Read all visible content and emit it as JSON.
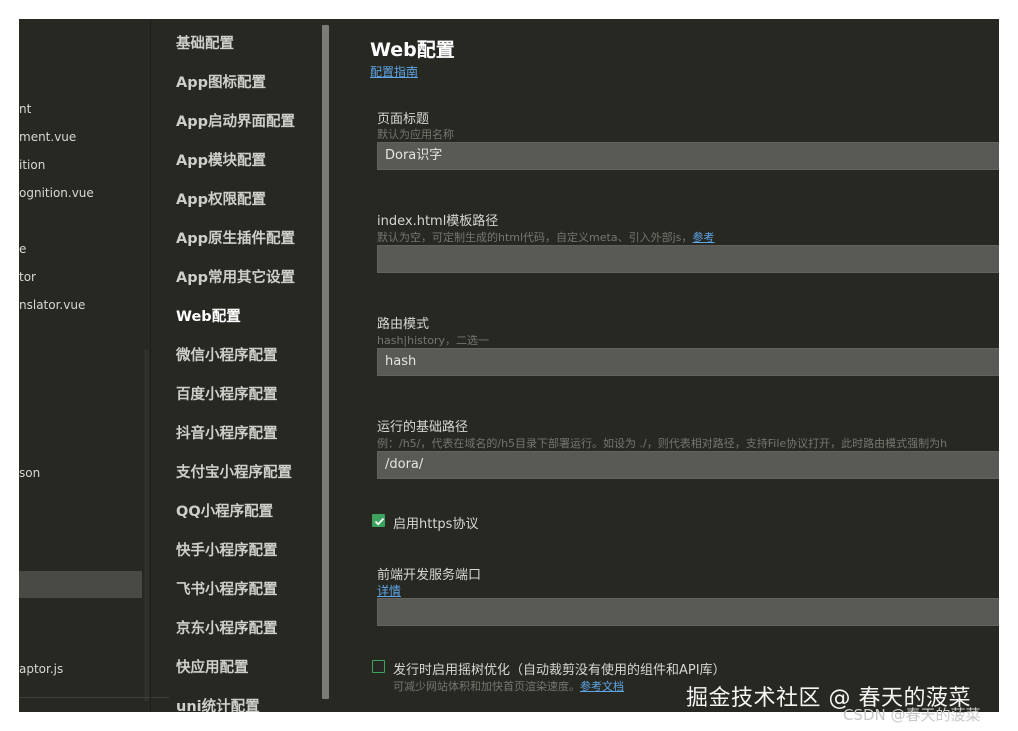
{
  "file_tree": {
    "items": [
      {
        "label": "nt"
      },
      {
        "label": "ment.vue"
      },
      {
        "label": "ition"
      },
      {
        "label": "ognition.vue"
      },
      {
        "label": "e"
      },
      {
        "label": "tor"
      },
      {
        "label": "nslator.vue"
      },
      {
        "label": "son"
      },
      {
        "label": "aptor.js"
      }
    ]
  },
  "settings_nav": {
    "items": [
      {
        "label": "基础配置"
      },
      {
        "label": "App图标配置"
      },
      {
        "label": "App启动界面配置"
      },
      {
        "label": "App模块配置"
      },
      {
        "label": "App权限配置"
      },
      {
        "label": "App原生插件配置"
      },
      {
        "label": "App常用其它设置"
      },
      {
        "label": "Web配置",
        "active": true
      },
      {
        "label": "微信小程序配置"
      },
      {
        "label": "百度小程序配置"
      },
      {
        "label": "抖音小程序配置"
      },
      {
        "label": "支付宝小程序配置"
      },
      {
        "label": "QQ小程序配置"
      },
      {
        "label": "快手小程序配置"
      },
      {
        "label": "飞书小程序配置"
      },
      {
        "label": "京东小程序配置"
      },
      {
        "label": "快应用配置"
      },
      {
        "label": "uni统计配置"
      }
    ]
  },
  "main": {
    "title": "Web配置",
    "guide_link": "配置指南",
    "page_title": {
      "label": "页面标题",
      "hint": "默认为应用名称",
      "value": "Dora识字"
    },
    "index_template": {
      "label": "index.html模板路径",
      "hint": "默认为空，可定制生成的html代码，自定义meta、引入外部js，",
      "hint_link": "参考",
      "value": ""
    },
    "router_mode": {
      "label": "路由模式",
      "hint": "hash|history，二选一",
      "value": "hash"
    },
    "base_path": {
      "label": "运行的基础路径",
      "hint": "例：/h5/，代表在域名的/h5目录下部署运行。如设为 ./，则代表相对路径，支持File协议打开，此时路由模式强制为h",
      "value": "/dora/"
    },
    "https": {
      "label": "启用https协议",
      "checked": true
    },
    "dev_port": {
      "label": "前端开发服务端口",
      "link": "详情",
      "value": ""
    },
    "tree_shaking": {
      "label": "发行时启用摇树优化（自动裁剪没有使用的组件和API库）",
      "hint": "可减少网站体积和加快首页渲染速度。",
      "hint_link": "参考文档",
      "checked": false
    }
  },
  "watermark": {
    "main": "掘金技术社区 @ 春天的菠菜",
    "sub": "CSDN @春天的菠菜"
  }
}
